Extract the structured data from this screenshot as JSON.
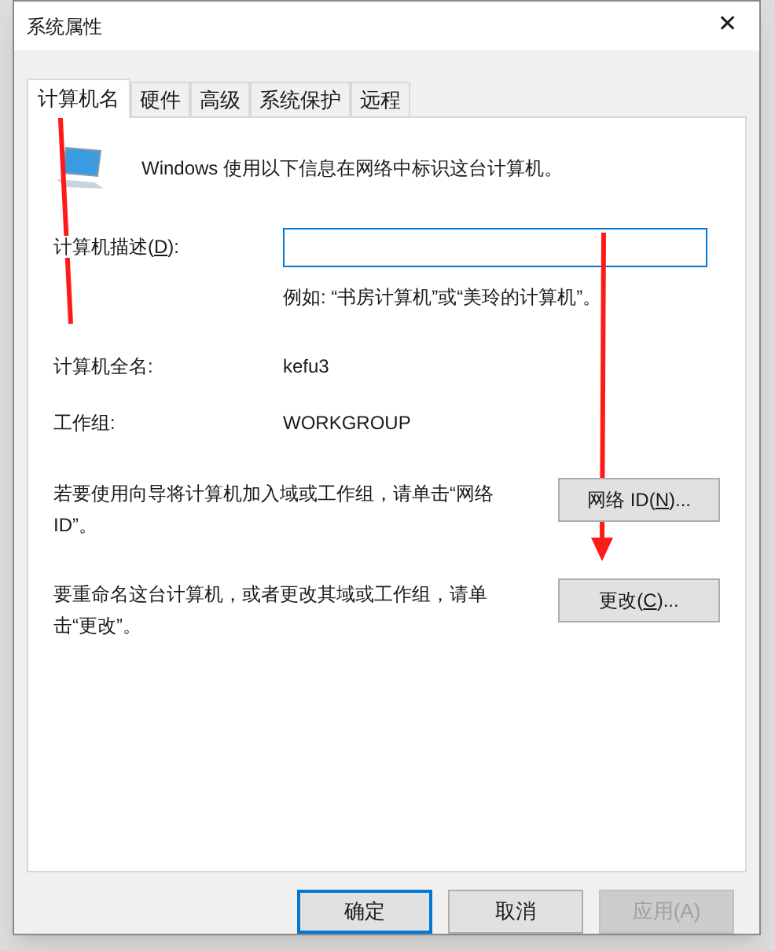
{
  "window": {
    "title": "系统属性",
    "close": "✕"
  },
  "tabs": [
    {
      "label": "计算机名",
      "selected": true
    },
    {
      "label": "硬件",
      "selected": false
    },
    {
      "label": "高级",
      "selected": false
    },
    {
      "label": "系统保护",
      "selected": false
    },
    {
      "label": "远程",
      "selected": false
    }
  ],
  "intro": "Windows 使用以下信息在网络中标识这台计算机。",
  "description": {
    "label": {
      "before": "计算机描述(",
      "key": "D",
      "after": "):"
    },
    "focused": true,
    "hint": "例如: “书房计算机”或“美玲的计算机”。"
  },
  "full_name": {
    "label": "计算机全名:",
    "value": "kefu3"
  },
  "workgroup": {
    "label": "工作组:",
    "value": "WORKGROUP"
  },
  "actions": [
    {
      "text": "若要使用向导将计算机加入域或工作组，请单击“网络 ID”。",
      "button": {
        "before": "网络 ID(",
        "key": "N",
        "after": ")..."
      }
    },
    {
      "text": "要重命名这台计算机，或者更改其域或工作组，请单击“更改”。",
      "button": {
        "before": "更改(",
        "key": "C",
        "after": ")..."
      }
    }
  ],
  "buttons": [
    {
      "label": "确定",
      "default": true,
      "disabled": false
    },
    {
      "label": "取消",
      "default": false,
      "disabled": false
    },
    {
      "label": "应用(A)",
      "default": false,
      "disabled": true
    }
  ]
}
